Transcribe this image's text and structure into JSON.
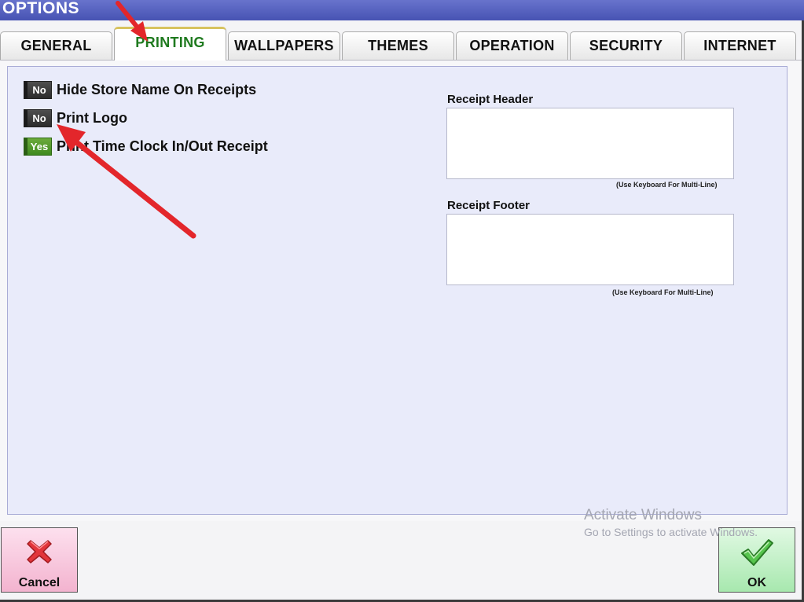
{
  "window": {
    "title": "OPTIONS"
  },
  "tabs": [
    {
      "label": "GENERAL",
      "active": false
    },
    {
      "label": "PRINTING",
      "active": true
    },
    {
      "label": "WALLPAPERS",
      "active": false
    },
    {
      "label": "THEMES",
      "active": false
    },
    {
      "label": "OPERATION",
      "active": false
    },
    {
      "label": "SECURITY",
      "active": false
    },
    {
      "label": "INTERNET",
      "active": false
    }
  ],
  "options": [
    {
      "label": "Hide Store Name On Receipts",
      "value": "No"
    },
    {
      "label": "Print Logo",
      "value": "No"
    },
    {
      "label": "Print Time Clock In/Out Receipt",
      "value": "Yes"
    }
  ],
  "receipt_header": {
    "label": "Receipt Header",
    "value": "",
    "hint": "(Use Keyboard For Multi-Line)"
  },
  "receipt_footer": {
    "label": "Receipt Footer",
    "value": "",
    "hint": "(Use Keyboard For Multi-Line)"
  },
  "buttons": {
    "cancel": "Cancel",
    "ok": "OK"
  },
  "watermark": {
    "line1": "Activate Windows",
    "line2": "Go to Settings to activate Windows."
  },
  "colors": {
    "title_bar": "#4753b3",
    "active_tab_text": "#1f7a1f",
    "panel_bg": "#e9ebfa",
    "annotation_arrow": "#e3262b"
  },
  "icons": {
    "cancel": "red-x-icon",
    "ok": "green-check-icon"
  }
}
